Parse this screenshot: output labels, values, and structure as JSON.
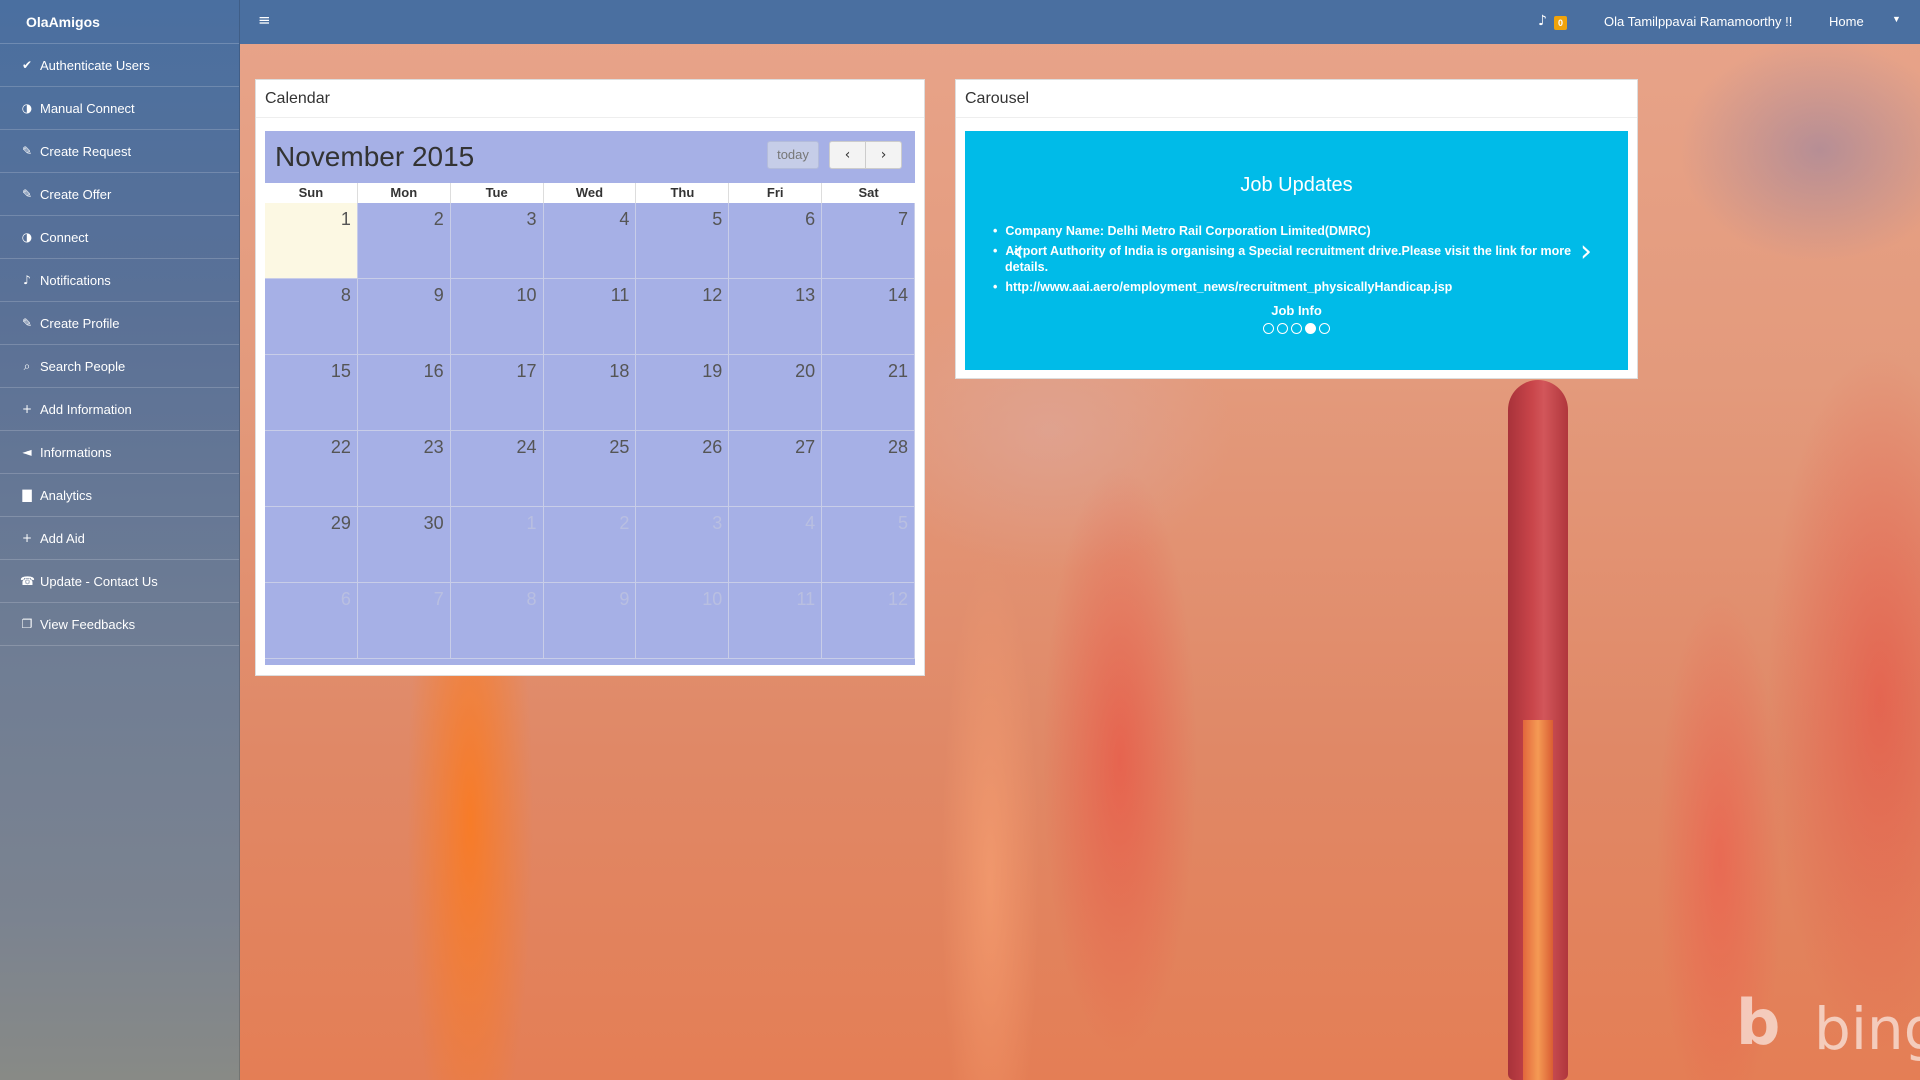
{
  "app": {
    "brand": "OlaAmigos"
  },
  "sidebar": {
    "items": [
      {
        "icon": "check-icon",
        "glyph": "✔",
        "label": "Authenticate Users"
      },
      {
        "icon": "half-circle-icon",
        "glyph": "◑",
        "label": "Manual Connect"
      },
      {
        "icon": "edit-icon",
        "glyph": "✎",
        "label": "Create Request"
      },
      {
        "icon": "edit-icon",
        "glyph": "✎",
        "label": "Create Offer"
      },
      {
        "icon": "half-circle-icon",
        "glyph": "◑",
        "label": "Connect"
      },
      {
        "icon": "bell-icon",
        "glyph": "♪",
        "label": "Notifications"
      },
      {
        "icon": "edit-icon",
        "glyph": "✎",
        "label": "Create Profile"
      },
      {
        "icon": "search-icon",
        "glyph": "⌕",
        "label": "Search People"
      },
      {
        "icon": "plus-icon",
        "glyph": "+",
        "label": "Add Information"
      },
      {
        "icon": "megaphone-icon",
        "glyph": "◄",
        "label": "Informations"
      },
      {
        "icon": "bar-chart-icon",
        "glyph": "▇",
        "label": "Analytics"
      },
      {
        "icon": "plus-icon",
        "glyph": "+",
        "label": "Add Aid"
      },
      {
        "icon": "phone-icon",
        "glyph": "☎",
        "label": "Update - Contact Us"
      },
      {
        "icon": "copy-icon",
        "glyph": "❐",
        "label": "View Feedbacks"
      }
    ]
  },
  "topbar": {
    "menu_glyph": "≡",
    "bell_glyph": "♪",
    "notification_count": "0",
    "user": "Ola Tamilppavai Ramamoorthy !!",
    "home": "Home",
    "caret": "▼"
  },
  "calendar": {
    "panel_title": "Calendar",
    "month_label": "November 2015",
    "today_label": "today",
    "prev_glyph": "‹",
    "next_glyph": "›",
    "weekdays": [
      "Sun",
      "Mon",
      "Tue",
      "Wed",
      "Thu",
      "Fri",
      "Sat"
    ],
    "weeks": [
      [
        "1",
        "2",
        "3",
        "4",
        "5",
        "6",
        "7"
      ],
      [
        "8",
        "9",
        "10",
        "11",
        "12",
        "13",
        "14"
      ],
      [
        "15",
        "16",
        "17",
        "18",
        "19",
        "20",
        "21"
      ],
      [
        "22",
        "23",
        "24",
        "25",
        "26",
        "27",
        "28"
      ],
      [
        "29",
        "30",
        "1",
        "2",
        "3",
        "4",
        "5"
      ],
      [
        "6",
        "7",
        "8",
        "9",
        "10",
        "11",
        "12"
      ]
    ],
    "other_month_start_week": 4,
    "other_month_start_index": 2,
    "today_day": "1"
  },
  "carousel": {
    "panel_title": "Carousel",
    "heading": "Job Updates",
    "items": [
      "Company Name: Delhi Metro Rail Corporation Limited(DMRC)",
      "Airport Authority of India is organising a Special recruitment drive.Please visit the link for more details.",
      "http://www.aai.aero/employment_news/recruitment_physicallyHandicap.jsp"
    ],
    "caption": "Job Info",
    "prev_glyph": "‹",
    "next_glyph": "›",
    "slide_count": 5,
    "active_slide": 4
  },
  "watermark": {
    "mark": "b",
    "text": "bing"
  }
}
